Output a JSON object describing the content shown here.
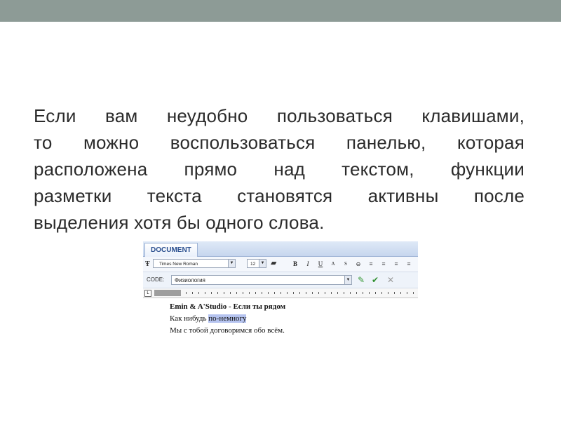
{
  "slide": {
    "paragraph_lines": [
      "Если вам неудобно пользоваться клавишами,",
      "то можно воспользоваться панелью, которая",
      "расположена прямо над текстом, функции",
      "разметки текста становятся активны после",
      "выделения хотя бы одного слова."
    ]
  },
  "colors": {
    "top_bar": "#8d9b96",
    "highlight": "#b5c3ef"
  },
  "editor": {
    "tab_label": "DOCUMENT",
    "font_name": "Times New Roman",
    "font_size": "12",
    "format_buttons": [
      "B",
      "I",
      "U",
      "A",
      "S",
      "⊖",
      "≡",
      "≡",
      "≡",
      "≡"
    ],
    "code_label": "CODE:",
    "code_value": "Физиология",
    "icons": [
      "font-icon",
      "paint-icon",
      "check-icon",
      "apply-icon",
      "cancel-icon"
    ],
    "doc_title": "Emin & A'Studio - Если ты рядом",
    "line2_plain": "Как нибудь ",
    "line2_selected": "по-немногу",
    "line3": "Мы с тобой договоримся обо всём."
  }
}
